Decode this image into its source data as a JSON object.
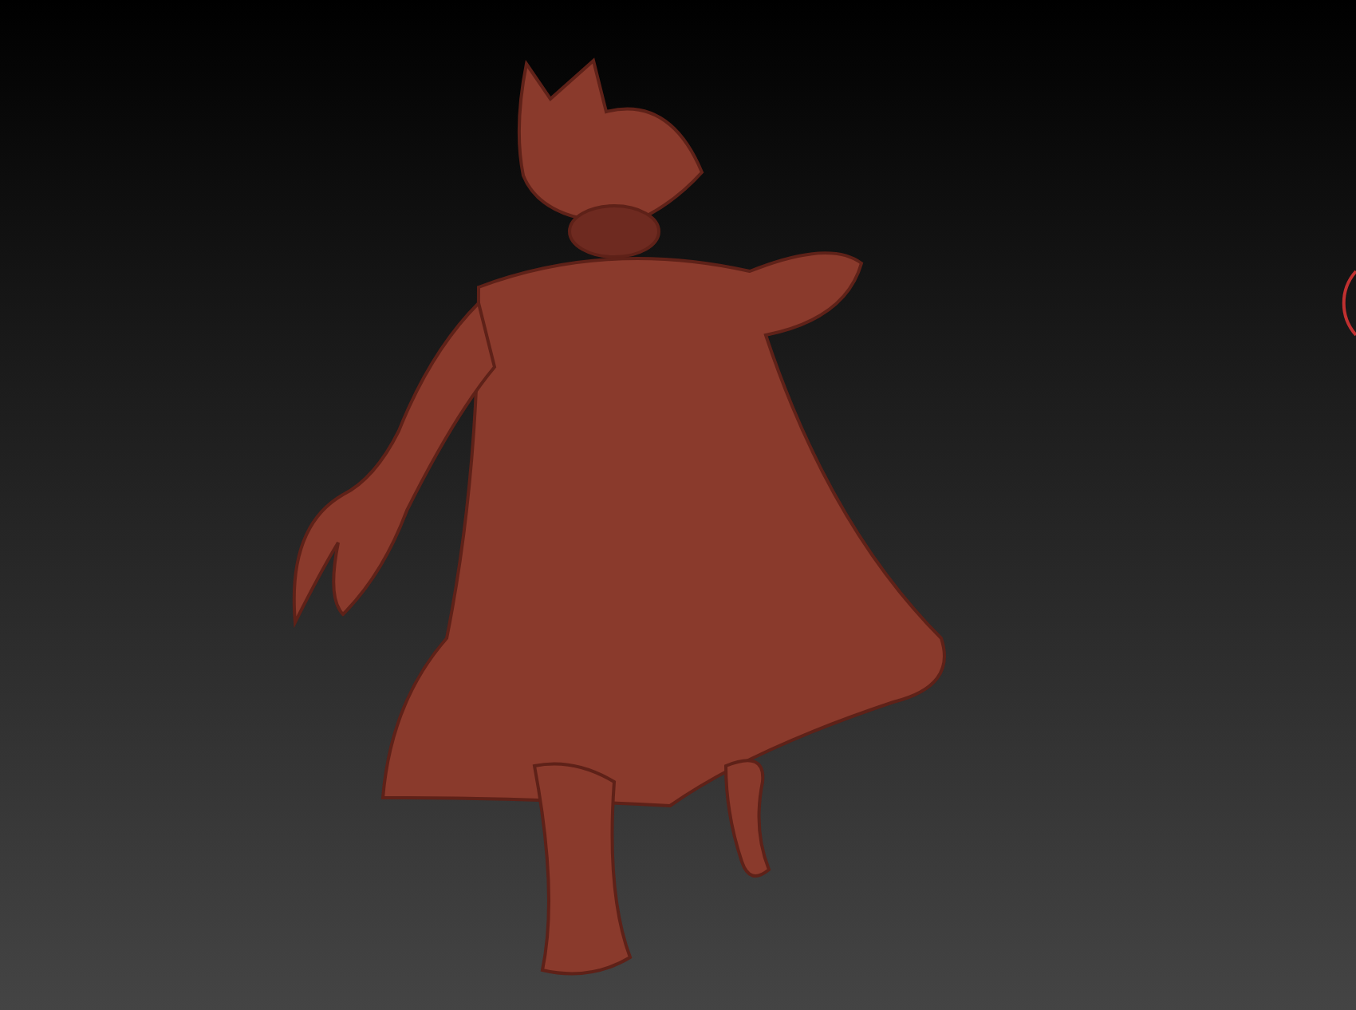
{
  "viewport": {
    "kind": "sculpt"
  }
}
